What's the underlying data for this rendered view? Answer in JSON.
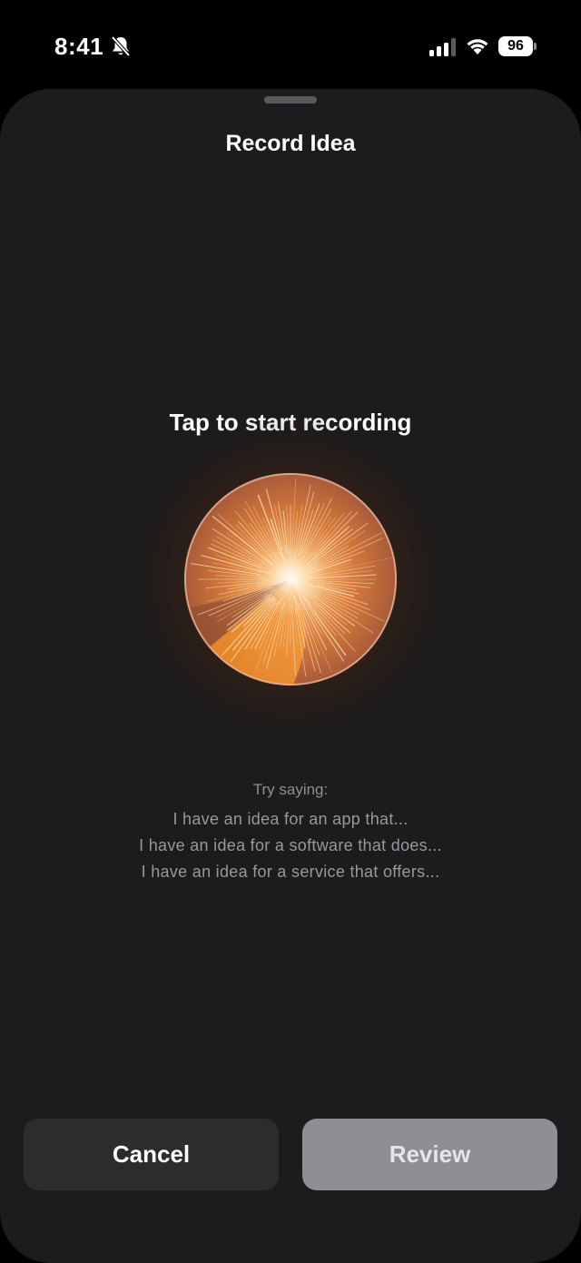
{
  "status_bar": {
    "time": "8:41",
    "battery": "96",
    "icons": [
      "bell-slash-icon",
      "cellular-signal-icon",
      "wifi-icon",
      "battery-icon"
    ]
  },
  "sheet": {
    "title": "Record Idea",
    "prompt": "Tap to start recording",
    "hints_heading": "Try saying:",
    "hints": [
      "I have an idea for an app that...",
      "I have an idea for a software that does...",
      "I have an idea for a service that offers..."
    ],
    "cancel_label": "Cancel",
    "review_label": "Review"
  },
  "colors": {
    "sheet_background": "#1c1c1e",
    "orb_accent": "#f0902c",
    "cancel_button": "#2c2c2e",
    "review_button_disabled": "#8e8e93"
  }
}
